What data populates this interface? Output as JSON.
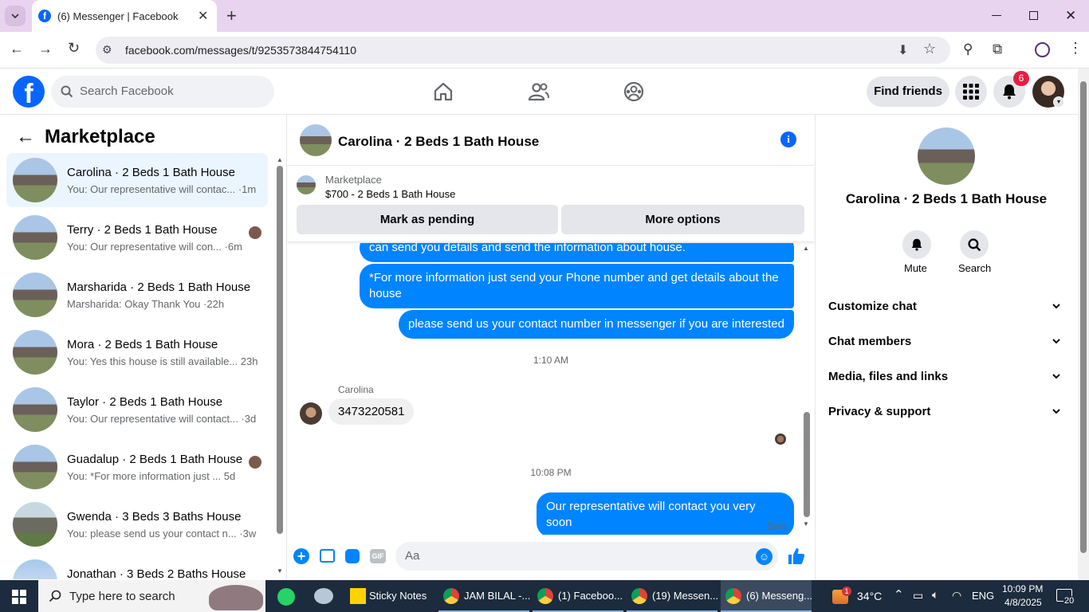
{
  "browser": {
    "tab_title": "(6) Messenger | Facebook",
    "url": "facebook.com/messages/t/9253573844754110"
  },
  "header": {
    "search_placeholder": "Search Facebook",
    "find_friends": "Find friends",
    "notification_count": "6"
  },
  "sidebar": {
    "title": "Marketplace",
    "conversations": [
      {
        "title": "Carolina · 2 Beds 1 Bath House",
        "preview": "You: Our representative will contac... ·1m"
      },
      {
        "title": "Terry · 2 Beds 1 Bath House",
        "preview": "You: Our representative will con... ·6m"
      },
      {
        "title": "Marsharida · 2 Beds 1 Bath House",
        "preview": "Marsharida: Okay Thank You ·22h"
      },
      {
        "title": "Mora · 2 Beds 1 Bath House",
        "preview": "You: Yes this house is still available... 23h"
      },
      {
        "title": "Taylor · 2 Beds 1 Bath House",
        "preview": "You: Our representative will contact... ·3d"
      },
      {
        "title": "Guadalup · 2 Beds 1 Bath House",
        "preview": "You: *For more information just ... 5d"
      },
      {
        "title": "Gwenda · 3 Beds 3 Baths House",
        "preview": "You: please send us your contact n... ·3w"
      },
      {
        "title": "Jonathan · 3 Beds 2 Baths House",
        "preview": ""
      }
    ]
  },
  "chat": {
    "title": "Carolina · 2 Beds 1 Bath House",
    "listing_source": "Marketplace",
    "listing_price": "$700 - 2 Beds 1 Bath House",
    "mark_pending": "Mark as pending",
    "more_options": "More options",
    "messages": {
      "m1": "can send you details and send the information about house.",
      "m2": "*For more information just send your Phone number and  get details about the house",
      "m3": "please  send us your contact number in messenger if you are interested",
      "ts1": "1:10 AM",
      "sender": "Carolina",
      "m4": "3473220581",
      "ts2": "10:08 PM",
      "m5": "Our representative will contact you very soon",
      "status": "Sent"
    },
    "composer_placeholder": "Aa"
  },
  "details": {
    "name": "Carolina · 2 Beds 1 Bath House",
    "mute": "Mute",
    "search": "Search",
    "sections": [
      "Customize chat",
      "Chat members",
      "Media, files and links",
      "Privacy & support"
    ]
  },
  "taskbar": {
    "search_placeholder": "Type here to search",
    "apps": [
      "Sticky Notes",
      "JAM BILAL -...",
      "(1) Faceboo...",
      "(19) Messen...",
      "(6) Messeng..."
    ],
    "weather": "34°C",
    "weather_badge": "1",
    "lang": "ENG",
    "time": "10:09 PM",
    "date": "4/8/2025",
    "notif_count": "20"
  },
  "colors": {
    "accent": "#0084ff",
    "fb_blue": "#0866ff",
    "taskbar": "#1c2b3d"
  }
}
